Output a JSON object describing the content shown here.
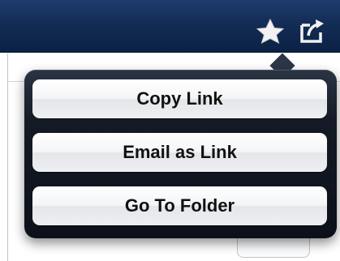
{
  "toolbar": {
    "favorite_icon": "star-icon",
    "share_icon": "share-icon"
  },
  "share_menu": {
    "items": [
      {
        "label": "Copy Link"
      },
      {
        "label": "Email as Link"
      },
      {
        "label": "Go To Folder"
      }
    ]
  },
  "colors": {
    "toolbar_background": "#122a52",
    "popover_background": "#151b26",
    "button_text": "#111111"
  }
}
